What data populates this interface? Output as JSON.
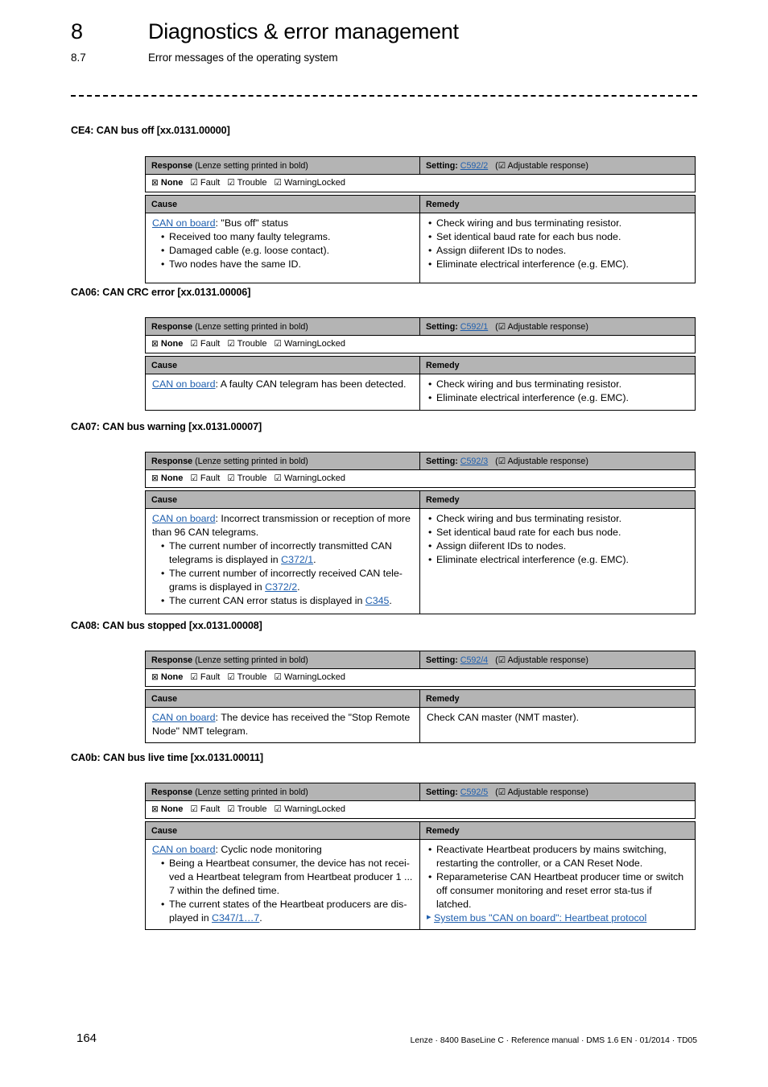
{
  "header": {
    "chapter_number": "8",
    "chapter_title": "Diagnostics & error management",
    "section_number": "8.7",
    "section_title": "Error messages of the operating system"
  },
  "common": {
    "response_header": "Response",
    "response_header_note": "(Lenze setting printed in bold)",
    "setting_label": "Setting:",
    "adjustable_note": "( Adjustable response)",
    "adjustable_checkbox": "☑",
    "cause_header": "Cause",
    "remedy_header": "Remedy",
    "options": [
      {
        "box": "⊠",
        "label": "None",
        "bold": true
      },
      {
        "box": "☑",
        "label": "Fault",
        "bold": false
      },
      {
        "box": "☑",
        "label": "Trouble",
        "bold": false
      },
      {
        "box": "☑",
        "label": "WarningLocked",
        "bold": false
      }
    ],
    "can_on_board_link": "CAN on board"
  },
  "sections": [
    {
      "title": "CE4: CAN bus off [xx.0131.00000]",
      "setting_link": "C592/2",
      "cause": {
        "lead_link": "CAN on board",
        "lead_text": ": \"Bus off\" status",
        "bullets": [
          "Received too many faulty telegrams.",
          "Damaged cable (e.g. loose contact).",
          "Two nodes have the same ID."
        ]
      },
      "remedy": {
        "bullets": [
          "Check wiring and bus terminating resistor.",
          "Set identical baud rate for each bus node.",
          "Assign diiferent IDs to nodes.",
          "Eliminate electrical interference (e.g. EMC)."
        ]
      }
    },
    {
      "title": "CA06: CAN CRC error [xx.0131.00006]",
      "setting_link": "C592/1",
      "cause": {
        "lead_link": "CAN on board",
        "lead_text": ": A faulty CAN telegram has been detected.",
        "bullets": []
      },
      "remedy": {
        "bullets": [
          "Check wiring and bus terminating resistor.",
          "Eliminate electrical interference (e.g. EMC)."
        ]
      }
    },
    {
      "title": "CA07: CAN bus warning [xx.0131.00007]",
      "setting_link": "C592/3",
      "cause": {
        "lead_link": "CAN on board",
        "lead_text": ": Incorrect transmission or reception of more than 96 CAN telegrams.",
        "bullets_rich": [
          {
            "pre": "The current number of incorrectly transmitted CAN telegrams is displayed in ",
            "link": "C372/1",
            "post": "."
          },
          {
            "pre": "The current number of incorrectly received CAN tele-grams is displayed in ",
            "link": "C372/2",
            "post": "."
          },
          {
            "pre": "The current CAN error status is displayed in ",
            "link": "C345",
            "post": "."
          }
        ]
      },
      "remedy": {
        "bullets": [
          "Check wiring and bus terminating resistor.",
          "Set identical baud rate for each bus node.",
          "Assign diiferent IDs to nodes.",
          "Eliminate electrical interference (e.g. EMC)."
        ]
      }
    },
    {
      "title": "CA08: CAN bus stopped [xx.0131.00008]",
      "setting_link": "C592/4",
      "cause": {
        "lead_link": "CAN on board",
        "lead_text": ": The device has received the \"Stop Remote Node\" NMT telegram.",
        "bullets": []
      },
      "remedy": {
        "plain": "Check CAN master (NMT master)."
      }
    },
    {
      "title": "CA0b: CAN bus live time [xx.0131.00011]",
      "setting_link": "C592/5",
      "cause": {
        "lead_link": "CAN on board",
        "lead_text": ": Cyclic node monitoring",
        "bullets_rich": [
          {
            "pre": "Being a Heartbeat consumer, the device has not recei-ved a Heartbeat telegram from Heartbeat producer 1 ... 7 within the defined time.",
            "link": "",
            "post": ""
          },
          {
            "pre": "The current states of the Heartbeat producers are dis-played in ",
            "link": "C347/1…7",
            "post": "."
          }
        ]
      },
      "remedy": {
        "bullets": [
          "Reactivate Heartbeat producers by mains switching, restarting the controller, or a CAN Reset Node.",
          "Reparameterise CAN Heartbeat producer time or switch off consumer monitoring and reset error sta-tus if latched."
        ],
        "xref": "System bus \"CAN on board\": Heartbeat protocol"
      }
    }
  ],
  "footer": {
    "page_number": "164",
    "note": "Lenze · 8400 BaseLine C · Reference manual · DMS 1.6 EN · 01/2014 · TD05"
  },
  "colors": {
    "link": "#1f5fae",
    "table_header_bg": "#b4b4b4",
    "border": "#000000"
  }
}
